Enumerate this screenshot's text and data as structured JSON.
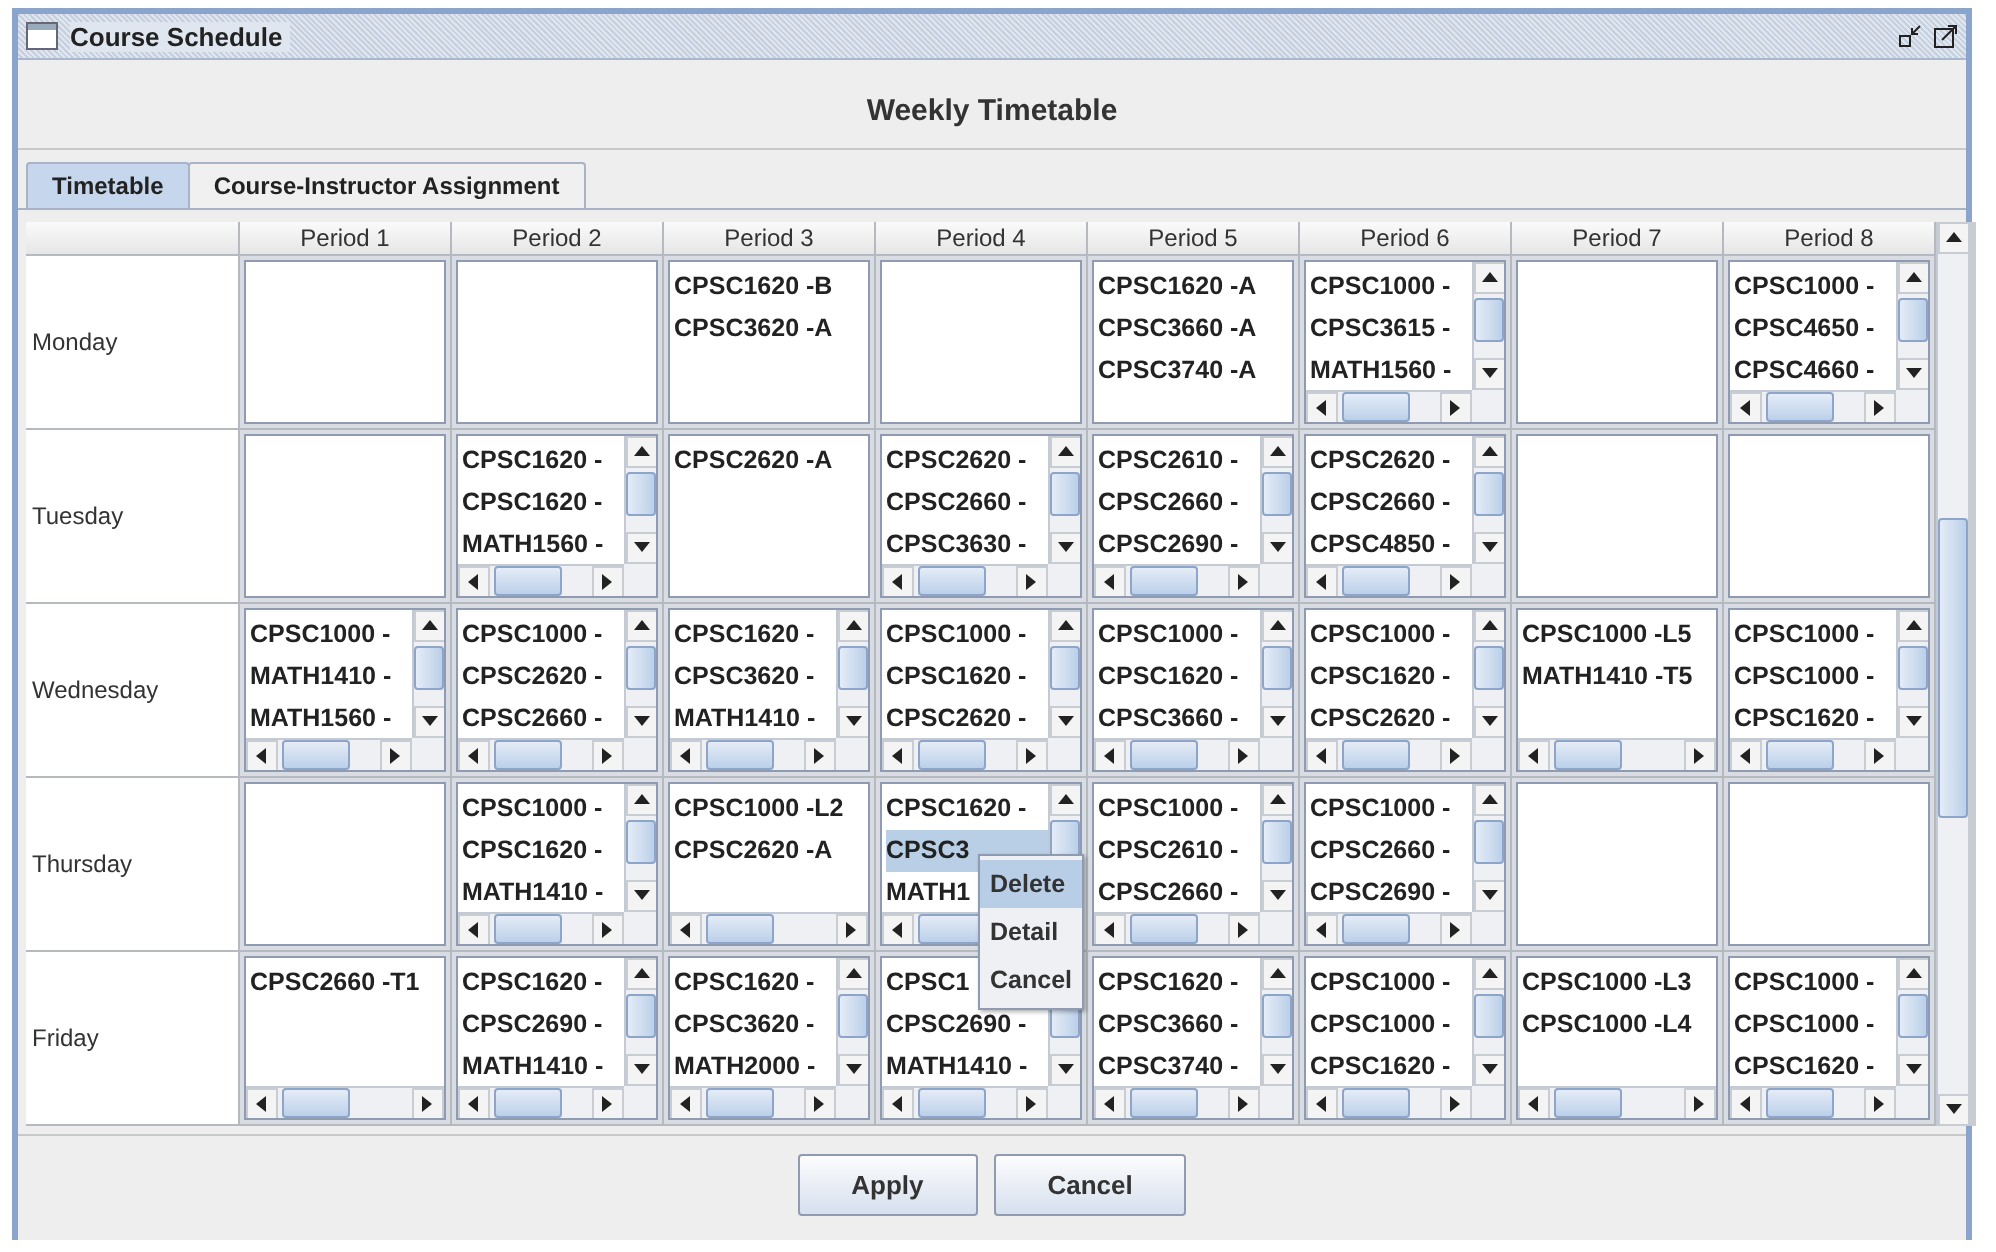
{
  "window": {
    "title": "Course Schedule"
  },
  "heading": "Weekly Timetable",
  "tabs": [
    {
      "label": "Timetable",
      "selected": true
    },
    {
      "label": "Course-Instructor Assignment",
      "selected": false
    }
  ],
  "table": {
    "columns": [
      "Period 1",
      "Period 2",
      "Period 3",
      "Period 4",
      "Period 5",
      "Period 6",
      "Period 7",
      "Period 8"
    ],
    "rows": [
      {
        "day": "Monday",
        "cells": [
          {
            "kind": "plain"
          },
          {
            "kind": "plain"
          },
          {
            "kind": "plain",
            "items": [
              {
                "text": "CPSC1620 -B",
                "selected": false
              },
              {
                "text": "CPSC3620 -A",
                "selected": false
              }
            ]
          },
          {
            "kind": "plain"
          },
          {
            "kind": "plain",
            "items": [
              {
                "text": "CPSC1620 -A",
                "selected": false
              },
              {
                "text": "CPSC3660 -A",
                "selected": false
              },
              {
                "text": "CPSC3740 -A",
                "selected": false
              }
            ]
          },
          {
            "kind": "scroll",
            "items": [
              {
                "text": "CPSC1000 -",
                "selected": false
              },
              {
                "text": "CPSC3615 -",
                "selected": false
              },
              {
                "text": "MATH1560 -",
                "selected": false
              }
            ]
          },
          {
            "kind": "plain"
          },
          {
            "kind": "scroll",
            "items": [
              {
                "text": "CPSC1000 -",
                "selected": false
              },
              {
                "text": "CPSC4650 -",
                "selected": false
              },
              {
                "text": "CPSC4660 -",
                "selected": false
              }
            ]
          }
        ]
      },
      {
        "day": "Tuesday",
        "cells": [
          {
            "kind": "plain"
          },
          {
            "kind": "scroll",
            "items": [
              {
                "text": "CPSC1620 -",
                "selected": false
              },
              {
                "text": "CPSC1620 -",
                "selected": false
              },
              {
                "text": "MATH1560 -",
                "selected": false
              }
            ]
          },
          {
            "kind": "plain",
            "items": [
              {
                "text": "CPSC2620 -A",
                "selected": false
              }
            ]
          },
          {
            "kind": "scroll",
            "items": [
              {
                "text": "CPSC2620 -",
                "selected": false
              },
              {
                "text": "CPSC2660 -",
                "selected": false
              },
              {
                "text": "CPSC3630 -",
                "selected": false
              }
            ]
          },
          {
            "kind": "scroll",
            "items": [
              {
                "text": "CPSC2610 -",
                "selected": false
              },
              {
                "text": "CPSC2660 -",
                "selected": false
              },
              {
                "text": "CPSC2690 -",
                "selected": false
              }
            ]
          },
          {
            "kind": "scroll",
            "items": [
              {
                "text": "CPSC2620 -",
                "selected": false
              },
              {
                "text": "CPSC2660 -",
                "selected": false
              },
              {
                "text": "CPSC4850 -",
                "selected": false
              }
            ]
          },
          {
            "kind": "plain"
          },
          {
            "kind": "plain"
          }
        ]
      },
      {
        "day": "Wednesday",
        "cells": [
          {
            "kind": "scroll",
            "items": [
              {
                "text": "CPSC1000 -",
                "selected": false
              },
              {
                "text": "MATH1410 -",
                "selected": false
              },
              {
                "text": "MATH1560 -",
                "selected": false
              }
            ]
          },
          {
            "kind": "scroll",
            "items": [
              {
                "text": "CPSC1000 -",
                "selected": false
              },
              {
                "text": "CPSC2620 -",
                "selected": false
              },
              {
                "text": "CPSC2660 -",
                "selected": false
              }
            ]
          },
          {
            "kind": "scroll",
            "items": [
              {
                "text": "CPSC1620 -",
                "selected": false
              },
              {
                "text": "CPSC3620 -",
                "selected": false
              },
              {
                "text": "MATH1410 -",
                "selected": false
              }
            ]
          },
          {
            "kind": "scroll",
            "items": [
              {
                "text": "CPSC1000 -",
                "selected": false
              },
              {
                "text": "CPSC1620 -",
                "selected": false
              },
              {
                "text": "CPSC2620 -",
                "selected": false
              }
            ]
          },
          {
            "kind": "scroll",
            "items": [
              {
                "text": "CPSC1000 -",
                "selected": false
              },
              {
                "text": "CPSC1620 -",
                "selected": false
              },
              {
                "text": "CPSC3660 -",
                "selected": false
              }
            ]
          },
          {
            "kind": "scroll",
            "items": [
              {
                "text": "CPSC1000 -",
                "selected": false
              },
              {
                "text": "CPSC1620 -",
                "selected": false
              },
              {
                "text": "CPSC2620 -",
                "selected": false
              }
            ]
          },
          {
            "kind": "hscroll",
            "items": [
              {
                "text": "CPSC1000 -L5",
                "selected": false
              },
              {
                "text": "MATH1410 -T5",
                "selected": false
              }
            ]
          },
          {
            "kind": "scroll",
            "items": [
              {
                "text": "CPSC1000 -",
                "selected": false
              },
              {
                "text": "CPSC1000 -",
                "selected": false
              },
              {
                "text": "CPSC1620 -",
                "selected": false
              }
            ]
          }
        ]
      },
      {
        "day": "Thursday",
        "cells": [
          {
            "kind": "plain"
          },
          {
            "kind": "scroll",
            "items": [
              {
                "text": "CPSC1000 -",
                "selected": false
              },
              {
                "text": "CPSC1620 -",
                "selected": false
              },
              {
                "text": "MATH1410 -",
                "selected": false
              }
            ]
          },
          {
            "kind": "hscroll",
            "items": [
              {
                "text": "CPSC1000 -L2",
                "selected": false
              },
              {
                "text": "CPSC2620 -A",
                "selected": false
              }
            ]
          },
          {
            "kind": "scroll",
            "lower_hidden": true,
            "items": [
              {
                "text": "CPSC1620 -",
                "selected": false
              },
              {
                "text": "CPSC3",
                "selected": true
              },
              {
                "text": "MATH1",
                "selected": false
              }
            ]
          },
          {
            "kind": "scroll",
            "items": [
              {
                "text": "CPSC1000 -",
                "selected": false
              },
              {
                "text": "CPSC2610 -",
                "selected": false
              },
              {
                "text": "CPSC2660 -",
                "selected": false
              }
            ]
          },
          {
            "kind": "scroll",
            "items": [
              {
                "text": "CPSC1000 -",
                "selected": false
              },
              {
                "text": "CPSC2660 -",
                "selected": false
              },
              {
                "text": "CPSC2690 -",
                "selected": false
              }
            ]
          },
          {
            "kind": "plain"
          },
          {
            "kind": "plain"
          }
        ]
      },
      {
        "day": "Friday",
        "cells": [
          {
            "kind": "hscroll",
            "items": [
              {
                "text": "CPSC2660 -T1",
                "selected": false
              }
            ]
          },
          {
            "kind": "scroll",
            "items": [
              {
                "text": "CPSC1620 -",
                "selected": false
              },
              {
                "text": "CPSC2690 -",
                "selected": false
              },
              {
                "text": "MATH1410 -",
                "selected": false
              }
            ]
          },
          {
            "kind": "scroll",
            "items": [
              {
                "text": "CPSC1620 -",
                "selected": false
              },
              {
                "text": "CPSC3620 -",
                "selected": false
              },
              {
                "text": "MATH2000 -",
                "selected": false
              }
            ]
          },
          {
            "kind": "scroll",
            "upper_hidden": true,
            "items": [
              {
                "text": "CPSC1",
                "selected": false
              },
              {
                "text": "CPSC2690 -",
                "selected": false
              },
              {
                "text": "MATH1410 -",
                "selected": false
              }
            ]
          },
          {
            "kind": "scroll",
            "items": [
              {
                "text": "CPSC1620 -",
                "selected": false
              },
              {
                "text": "CPSC3660 -",
                "selected": false
              },
              {
                "text": "CPSC3740 -",
                "selected": false
              }
            ]
          },
          {
            "kind": "scroll",
            "items": [
              {
                "text": "CPSC1000 -",
                "selected": false
              },
              {
                "text": "CPSC1000 -",
                "selected": false
              },
              {
                "text": "CPSC1620 -",
                "selected": false
              }
            ]
          },
          {
            "kind": "hscroll",
            "items": [
              {
                "text": "CPSC1000 -L3",
                "selected": false
              },
              {
                "text": "CPSC1000 -L4",
                "selected": false
              }
            ]
          },
          {
            "kind": "scroll",
            "items": [
              {
                "text": "CPSC1000 -",
                "selected": false
              },
              {
                "text": "CPSC1000 -",
                "selected": false
              },
              {
                "text": "CPSC1620 -",
                "selected": false
              }
            ]
          }
        ]
      }
    ]
  },
  "context_menu": [
    {
      "label": "Delete",
      "selected": true
    },
    {
      "label": "Detail",
      "selected": false
    },
    {
      "label": "Cancel",
      "selected": false
    }
  ],
  "buttons": [
    "Apply",
    "Cancel"
  ]
}
